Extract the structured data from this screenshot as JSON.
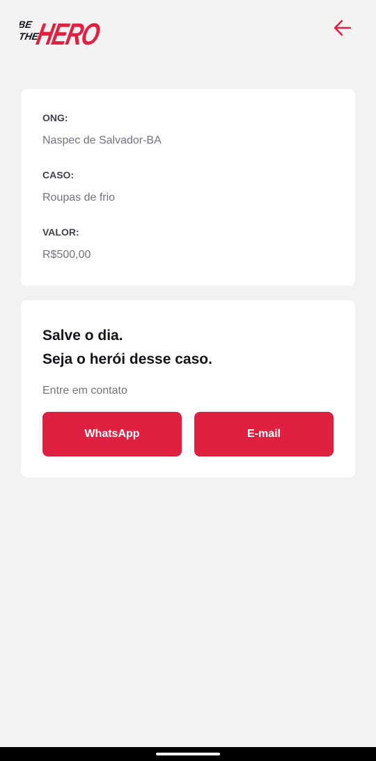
{
  "app": {
    "logo_text_small": [
      "BE",
      "THE"
    ],
    "logo_text_big": "HERO",
    "back_icon": "arrow-left-icon"
  },
  "incident": {
    "ong_label": "ONG:",
    "ong_value": "Naspec de Salvador-BA",
    "case_label": "CASO:",
    "case_value": "Roupas de frio",
    "value_label": "VALOR:",
    "value_value": "R$500,00"
  },
  "contact": {
    "title_line1": "Salve o dia.",
    "title_line2": "Seja o herói desse caso.",
    "description": "Entre em contato",
    "whatsapp_label": "WhatsApp",
    "email_label": "E-mail"
  },
  "colors": {
    "accent": "#e02041",
    "background": "#f2f2f2",
    "card": "#ffffff"
  }
}
